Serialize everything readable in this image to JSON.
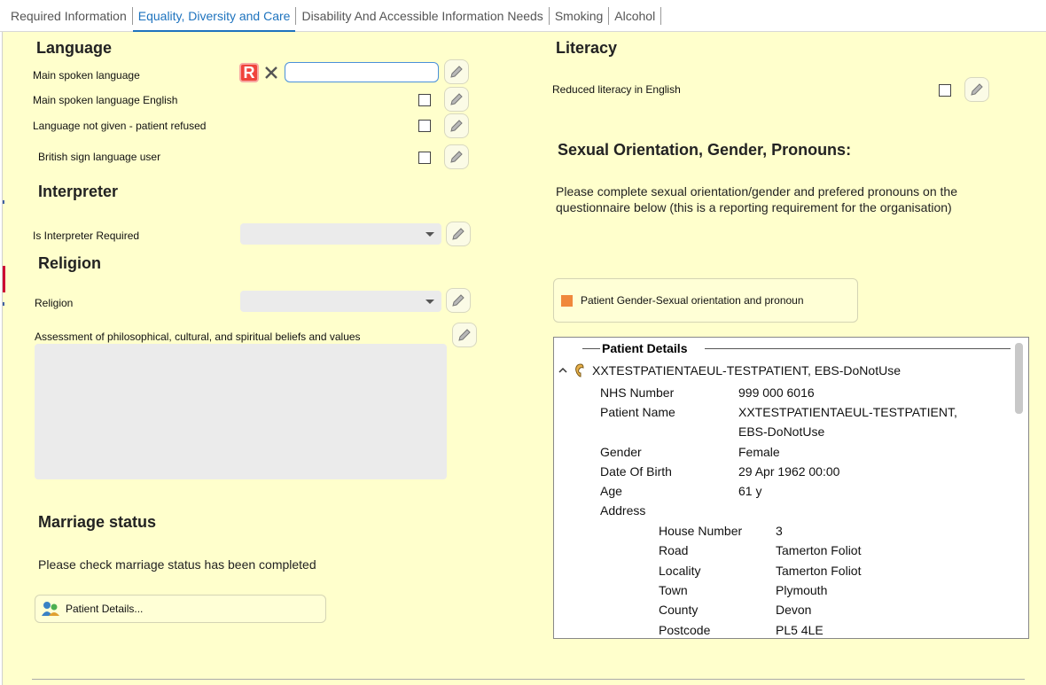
{
  "tabs": [
    {
      "label": "Required Information",
      "active": false
    },
    {
      "label": "Equality, Diversity and Care",
      "active": true
    },
    {
      "label": "Disability And Accessible Information Needs",
      "active": false
    },
    {
      "label": "Smoking",
      "active": false
    },
    {
      "label": "Alcohol",
      "active": false
    }
  ],
  "language": {
    "heading": "Language",
    "main_spoken": "Main spoken language",
    "required_badge": "R",
    "main_spoken_value": "",
    "main_spoken_english": "Main spoken language English",
    "not_given": "Language not given - patient refused",
    "bsl": "British sign language user"
  },
  "interpreter": {
    "heading": "Interpreter",
    "required_label": "Is Interpreter Required",
    "required_value": ""
  },
  "religion": {
    "heading": "Religion",
    "label": "Religion",
    "value": "",
    "assessment_label": "Assessment of philosophical, cultural, and spiritual beliefs and values",
    "assessment_value": ""
  },
  "marriage": {
    "heading": "Marriage status",
    "message": "Please check marriage status has been completed",
    "button": "Patient Details..."
  },
  "literacy": {
    "heading": "Literacy",
    "reduced": "Reduced literacy in English"
  },
  "sogp": {
    "heading": "Sexual Orientation, Gender, Pronouns:",
    "message": "Please complete sexual orientation/gender and prefered pronouns on the questionnaire below (this is a reporting requirement for the organisation)",
    "button": "Patient Gender-Sexual orientation and pronoun"
  },
  "patient_details": {
    "legend": "Patient Details",
    "patient_line": "XXTESTPATIENTAEUL-TESTPATIENT, EBS-DoNotUse",
    "nhs_label": "NHS Number",
    "nhs_value": "999 000 6016",
    "name_label": "Patient Name",
    "name_value_1": "XXTESTPATIENTAEUL-TESTPATIENT,",
    "name_value_2": "EBS-DoNotUse",
    "gender_label": "Gender",
    "gender_value": "Female",
    "dob_label": "Date Of Birth",
    "dob_value": "29 Apr 1962 00:00",
    "age_label": "Age",
    "age_value": "61 y",
    "address_label": "Address",
    "house_label": "House Number",
    "house_value": "3",
    "road_label": "Road",
    "road_value": "Tamerton Foliot",
    "locality_label": "Locality",
    "locality_value": "Tamerton Foliot",
    "town_label": "Town",
    "town_value": "Plymouth",
    "county_label": "County",
    "county_value": "Devon",
    "postcode_label": "Postcode",
    "postcode_value": "PL5 4LE"
  },
  "colors": {
    "accent": "#1e73be",
    "background": "#ffffcc",
    "required": "#f0443c",
    "orange_square": "#f0883c"
  }
}
